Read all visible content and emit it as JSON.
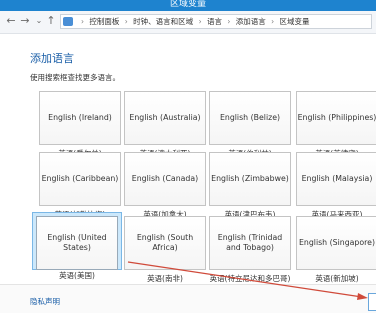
{
  "window": {
    "title": "区域变量"
  },
  "address_bar": {
    "crumbs": [
      "控制面板",
      "时钟、语言和区域",
      "语言",
      "添加语言",
      "区域变量"
    ]
  },
  "page": {
    "heading": "添加语言",
    "subtext": "使用搜索框查找更多语言。"
  },
  "languages": [
    {
      "name": "English (Ireland)",
      "caption": "英语(爱尔兰)"
    },
    {
      "name": "English (Australia)",
      "caption": "英语(澳大利亚)"
    },
    {
      "name": "English (Belize)",
      "caption": "英语(伯利兹)"
    },
    {
      "name": "English (Philippines)",
      "caption": "英语(菲律宾)"
    },
    {
      "name": "English (Caribbean)",
      "caption": "英语(加勒比海)"
    },
    {
      "name": "English (Canada)",
      "caption": "英语(加拿大)"
    },
    {
      "name": "English (Zimbabwe)",
      "caption": "英语(津巴布韦)"
    },
    {
      "name": "English (Malaysia)",
      "caption": "英语(马来西亚)"
    },
    {
      "name": "English (United States)",
      "caption": "英语(美国)",
      "selected": true
    },
    {
      "name": "English (South Africa)",
      "caption": "英语(南非)"
    },
    {
      "name": "English (Trinidad and Tobago)",
      "caption": "英语(特立尼达和多巴哥)"
    },
    {
      "name": "English (Singapore)",
      "caption": "英语(新加坡)"
    }
  ],
  "footer": {
    "privacy_link": "隐私声明"
  },
  "colors": {
    "titlebar": "#1e83cf",
    "link": "#1b5fa8",
    "selected": "#cce8fb",
    "arrow": "#d04a3a"
  }
}
